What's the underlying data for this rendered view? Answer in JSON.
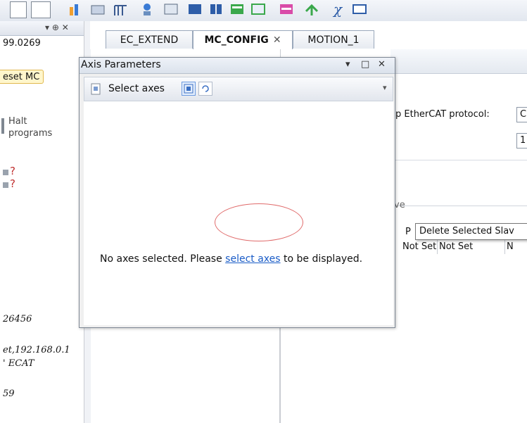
{
  "toolbar": {
    "icons": [
      "window-icon",
      "dropdown-icon",
      "chart-icon",
      "config-icon",
      "table-icon",
      "axis-icon",
      "settings-icon",
      "matrix-icon",
      "grid-icon",
      "window-layout-icon",
      "table-view-icon",
      "network-icon",
      "function-icon",
      "monitor-icon",
      "gear-icon"
    ]
  },
  "left_panel": {
    "controls": "▾ ⊕ ✕",
    "version": "99.0269",
    "reset_button": "eset MC",
    "halt_label_1": "Halt",
    "halt_label_2": "programs",
    "q1": "?",
    "q2": "?",
    "serial": "26456",
    "net": "et,192.168.0.1",
    "ecat": "' ECAT",
    "last": "59"
  },
  "tabs": {
    "tab1": "EC_EXTEND",
    "tab2": "MC_CONFIG",
    "tab2_close": "✕",
    "tab3": "MOTION_1"
  },
  "editor": {
    "protocol_label": "p EtherCAT protocol:",
    "protocol_value": "C",
    "speed_value": "1",
    "grid_header": "ve",
    "grid_row": [
      "Not Set",
      "Not Set",
      "N"
    ],
    "grid_partial": "P"
  },
  "tooltip": "Delete Selected Slav",
  "axis_window": {
    "title": "Axis Parameters",
    "controls_dropdown": "▾",
    "controls_max": "□",
    "controls_close": "✕",
    "select_axes_label": "Select axes",
    "message_pre": "No axes selected. Please ",
    "message_link": "select axes",
    "message_post": " to be displayed."
  },
  "colors": {
    "accent_link": "#1a5cc7",
    "highlight": "#e06b6b",
    "reset_bg": "#fff6cc"
  }
}
